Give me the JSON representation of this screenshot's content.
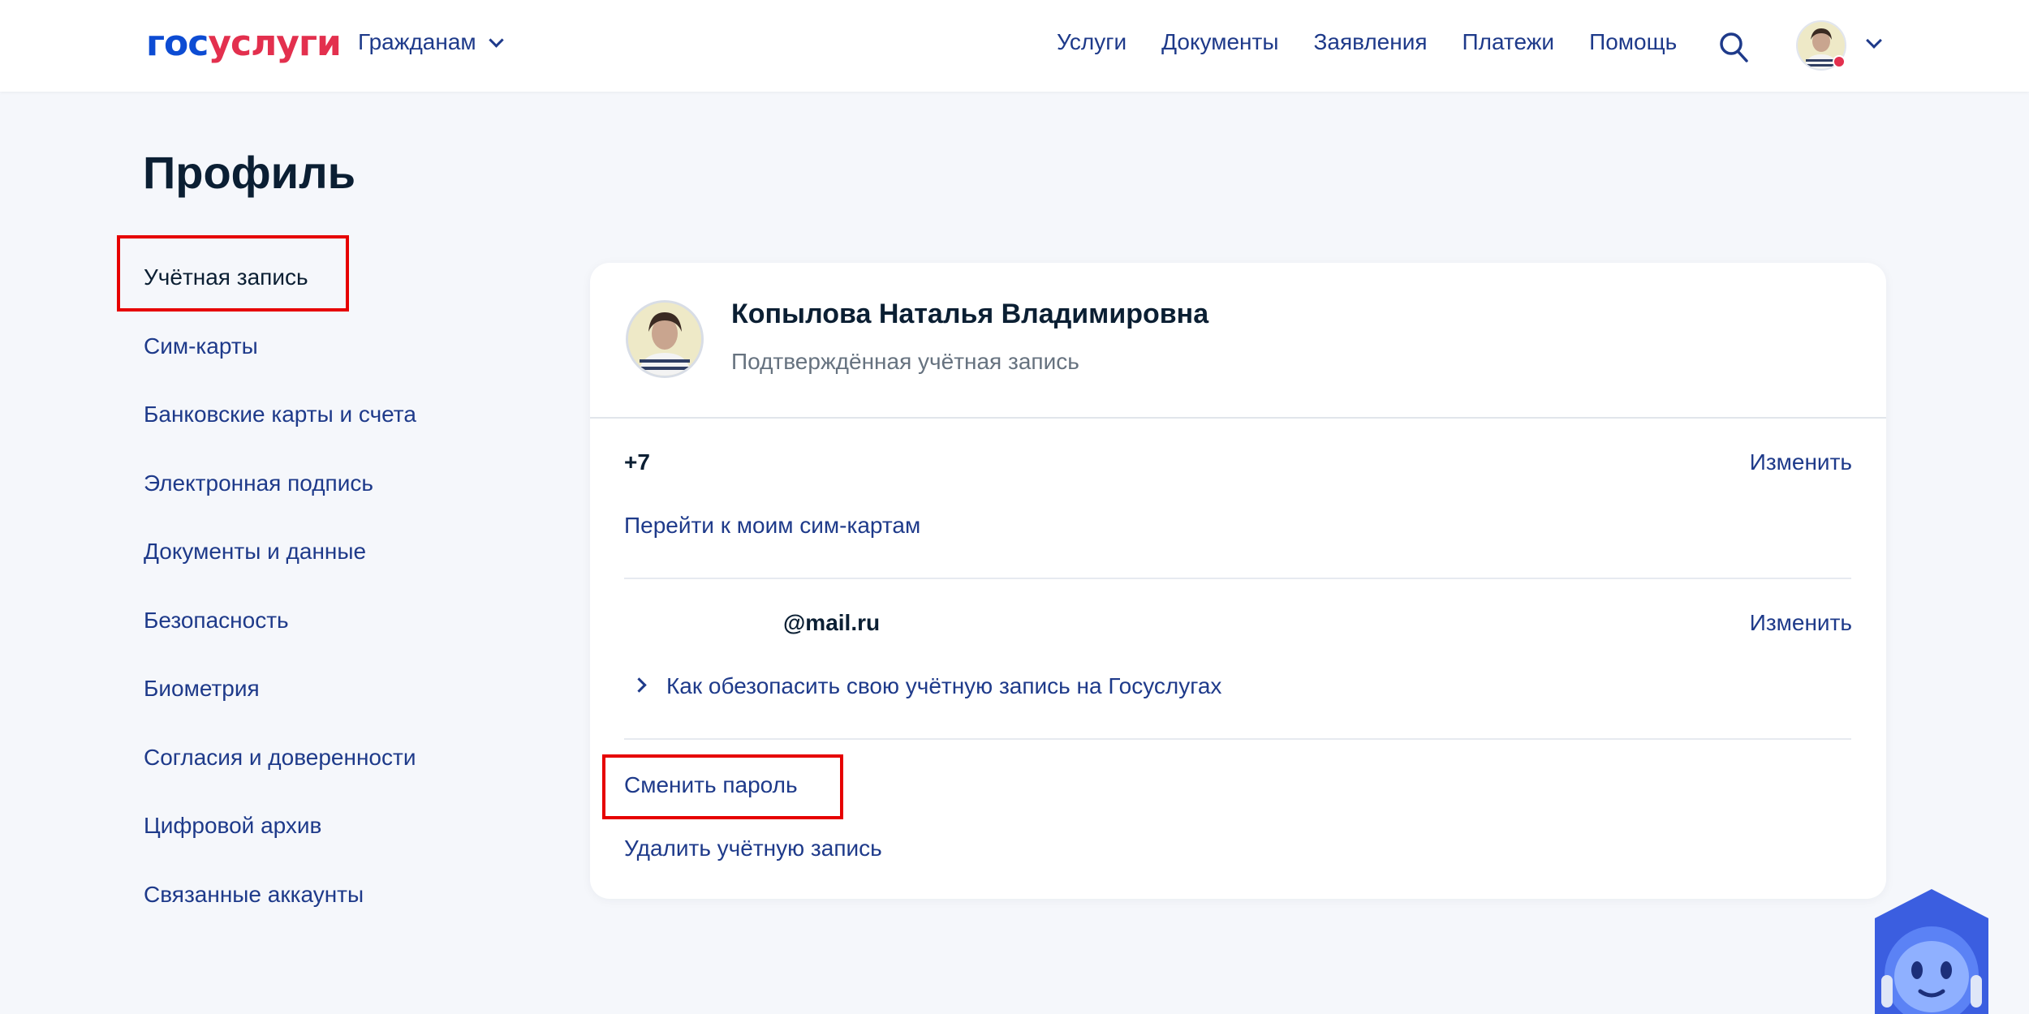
{
  "header": {
    "logo_part1": "гос",
    "logo_part2": "услуги",
    "role": "Гражданам",
    "nav": [
      "Услуги",
      "Документы",
      "Заявления",
      "Платежи",
      "Помощь"
    ]
  },
  "page": {
    "title": "Профиль"
  },
  "sidebar": {
    "items": [
      "Учётная запись",
      "Сим-карты",
      "Банковские карты и счета",
      "Электронная подпись",
      "Документы и данные",
      "Безопасность",
      "Биометрия",
      "Согласия и доверенности",
      "Цифровой архив",
      "Связанные аккаунты"
    ]
  },
  "account": {
    "name": "Копылова Наталья Владимировна",
    "status": "Подтверждённая учётная запись",
    "phone": "+7",
    "phone_edit": "Изменить",
    "sim_link": "Перейти к моим сим-картам",
    "email": "@mail.ru",
    "email_edit": "Изменить",
    "security_tip": "Как обезопасить свою учётную запись на Госуслугах",
    "change_password": "Сменить пароль",
    "delete_account": "Удалить учётную запись"
  },
  "colors": {
    "brand_blue": "#0d4cd3",
    "brand_red": "#e3304e",
    "link": "#1e3a8a",
    "highlight": "#e60000"
  }
}
